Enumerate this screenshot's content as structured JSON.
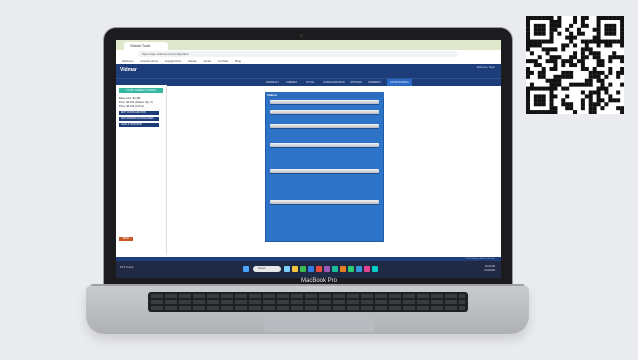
{
  "device": {
    "model_label": "MacBook Pro"
  },
  "browser": {
    "tab_title": "Vidmar Tools",
    "address": "https://app.vidmar.com/configurator",
    "bookmarks": [
      "Welcome",
      "Upwork Home",
      "Google Drive",
      "Sheets",
      "Gmail",
      "YouTube",
      "Bing"
    ]
  },
  "site": {
    "logo": "Vidmar",
    "account": "Welcome, Ryan",
    "nav": [
      "PRODUCT",
      "CABINET",
      "STYLE",
      "CONFIGURATION",
      "OPTIONS",
      "SUMMARY",
      "ACCESSORIES"
    ],
    "nav_active": "ACCESSORIES",
    "footer": "© 2023 Stanley Black & Decker"
  },
  "sidebar": {
    "title": "YOUR CABINET CONFIG",
    "lines": [
      "Base price: $2,480",
      "Price: $4,812 (Drawer Qty: 6)",
      "Price: $3,195 (CAT-5)"
    ],
    "buttons": [
      "EDIT CONFIGURATION",
      "ADD DRAWER ACCESSORIES",
      "SAVE & CONTINUE"
    ],
    "bottom_button": "BACK"
  },
  "cabinet": {
    "brand": "Vidmar",
    "color": "#2d73c8",
    "drawer_handle_levels": [
      0.05,
      0.12,
      0.21,
      0.34,
      0.51,
      0.72
    ]
  },
  "taskbar": {
    "weather": "62°F Sunny",
    "search_placeholder": "Search",
    "time": "10:42 AM",
    "date": "6/14/2023"
  }
}
